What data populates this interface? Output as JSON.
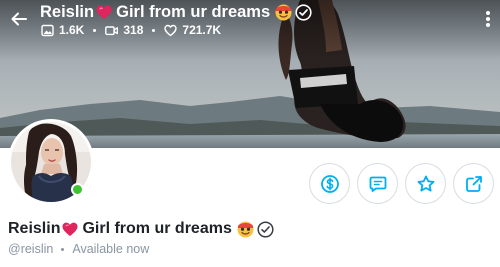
{
  "profile": {
    "display_name": "Reislin",
    "display_name_rest": "Girl from ur dreams",
    "handle": "@reislin",
    "status": "Available now"
  },
  "stats": {
    "photos": "1.6K",
    "videos": "318",
    "likes": "721.7K"
  },
  "icons": {
    "back": "arrow-left-icon",
    "more": "more-vertical-icon",
    "heart": "heart-emoji-icon",
    "face": "star-struck-emoji-icon",
    "verified": "verified-badge-icon",
    "photo": "image-icon",
    "video": "video-icon",
    "like": "heart-outline-icon",
    "tip": "dollar-icon",
    "message": "message-icon",
    "favorite": "star-icon",
    "share": "share-icon"
  },
  "colors": {
    "accent": "#00aff0",
    "online": "#3cc42e",
    "muted_text": "#8a96a3",
    "heart": "#e0245e"
  }
}
